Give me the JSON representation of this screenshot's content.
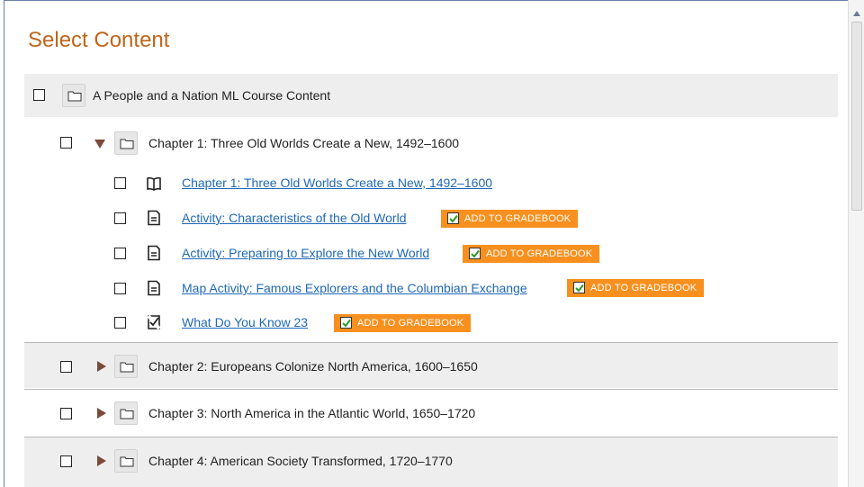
{
  "title": "Select Content",
  "root": {
    "label": "A People and a Nation ML Course Content"
  },
  "chapters": [
    {
      "label": "Chapter 1: Three Old Worlds Create a New, 1492–1600",
      "expanded": true,
      "items": [
        {
          "label": "Chapter 1: Three Old Worlds Create a New, 1492–1600",
          "icon": "book-icon",
          "gradebook": false
        },
        {
          "label": "Activity: Characteristics of the Old World",
          "icon": "document-icon",
          "gradebook": true
        },
        {
          "label": "Activity: Preparing to Explore the New World",
          "icon": "document-icon",
          "gradebook": true
        },
        {
          "label": "Map Activity: Famous Explorers and the Columbian Exchange",
          "icon": "document-icon",
          "gradebook": true
        },
        {
          "label": "What Do You Know 23",
          "icon": "quiz-icon",
          "gradebook": true
        }
      ]
    },
    {
      "label": "Chapter 2: Europeans Colonize North America, 1600–1650",
      "expanded": false
    },
    {
      "label": "Chapter 3: North America in the Atlantic World, 1650–1720",
      "expanded": false
    },
    {
      "label": "Chapter 4: American Society Transformed, 1720–1770",
      "expanded": false
    }
  ],
  "gradebook_label": "ADD TO GRADEBOOK",
  "colors": {
    "title": "#c0651b",
    "link": "#1f68b7",
    "gradebook": "#f7901e",
    "triangle": "#7b4b3a",
    "row_shade": "#eeeeee"
  }
}
